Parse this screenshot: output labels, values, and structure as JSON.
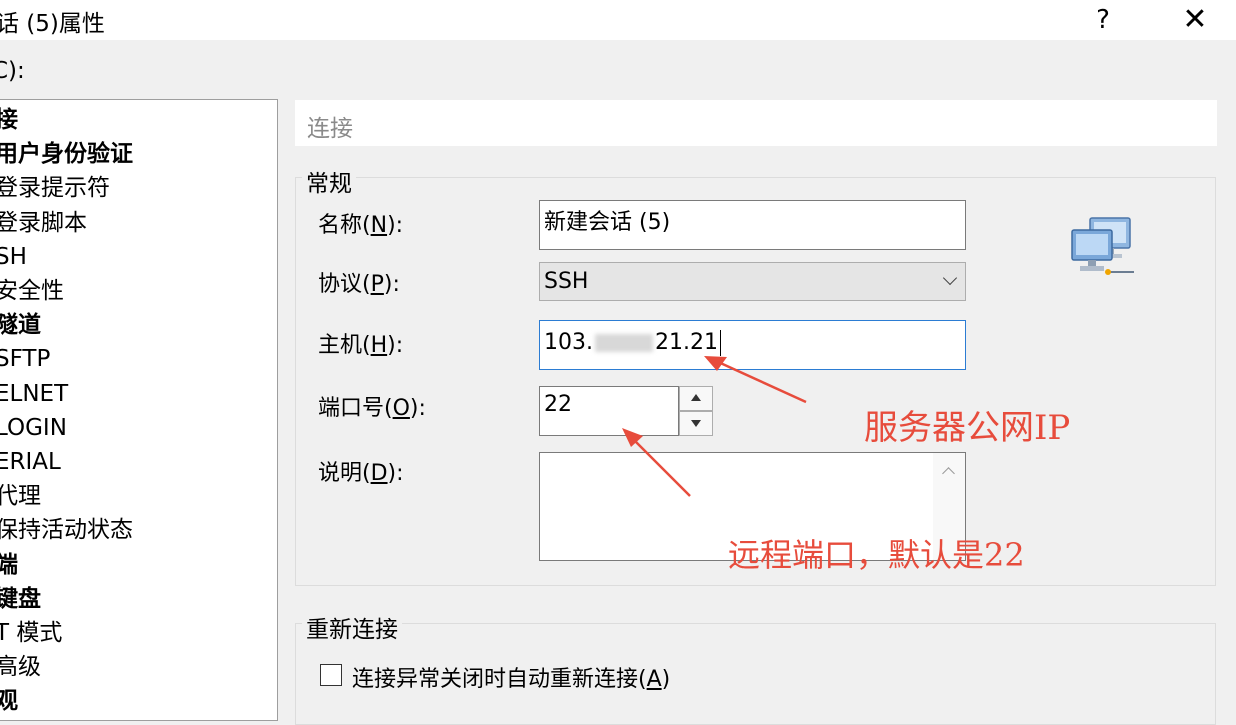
{
  "window": {
    "title": "话 (5)属性",
    "help_label": "?",
    "close_label": "✕"
  },
  "category_label": "C):",
  "tree": {
    "items": [
      {
        "label": "接",
        "bold": true
      },
      {
        "label": "用户身份验证",
        "bold": true
      },
      {
        "label": "登录提示符",
        "bold": false
      },
      {
        "label": "登录脚本",
        "bold": false
      },
      {
        "label": "SH",
        "bold": false
      },
      {
        "label": "安全性",
        "bold": false
      },
      {
        "label": "隧道",
        "bold": true
      },
      {
        "label": "SFTP",
        "bold": false
      },
      {
        "label": "ELNET",
        "bold": false
      },
      {
        "label": "LOGIN",
        "bold": false
      },
      {
        "label": "ERIAL",
        "bold": false
      },
      {
        "label": "代理",
        "bold": false
      },
      {
        "label": "保持活动状态",
        "bold": false
      },
      {
        "label": "端",
        "bold": true
      },
      {
        "label": "键盘",
        "bold": true
      },
      {
        "label": "T 模式",
        "bold": false
      },
      {
        "label": "高级",
        "bold": false
      },
      {
        "label": "观",
        "bold": true
      }
    ]
  },
  "section_header": "连接",
  "general": {
    "title": "常规",
    "name_label_pre": "名称(",
    "name_label_key": "N",
    "name_label_post": "):",
    "name_value": "新建会话 (5)",
    "protocol_label_pre": "协议(",
    "protocol_label_key": "P",
    "protocol_label_post": "):",
    "protocol_value": "SSH",
    "host_label_pre": "主机(",
    "host_label_key": "H",
    "host_label_post": "):",
    "host_value_start": "103.",
    "host_value_end": "21.21",
    "port_label_pre": "端口号(",
    "port_label_key": "O",
    "port_label_post": "):",
    "port_value": "22",
    "desc_label_pre": "说明(",
    "desc_label_key": "D",
    "desc_label_post": "):",
    "desc_value": ""
  },
  "annotations": {
    "ip_note": "服务器公网IP",
    "port_note": "远程端口，默认是22"
  },
  "reconnect": {
    "title": "重新连接",
    "checkbox_label_pre": "连接异常关闭时自动重新连接(",
    "checkbox_label_key": "A",
    "checkbox_label_post": ")",
    "checked": false
  },
  "colors": {
    "annotation": "#e74c3c",
    "focus_border": "#2b7cd3"
  },
  "icons": {
    "session": "network-computers-icon"
  }
}
